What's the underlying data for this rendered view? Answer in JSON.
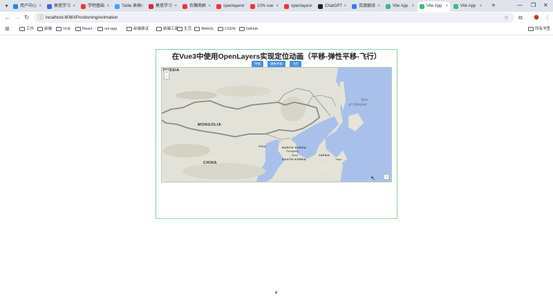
{
  "browser": {
    "tabs": [
      {
        "label": "用户中心",
        "color": "#1e88e5",
        "active": false
      },
      {
        "label": "莫塔学习",
        "color": "#3b6bd6",
        "active": false
      },
      {
        "label": "学吧基础",
        "color": "#e53935",
        "active": false
      },
      {
        "label": "Table 表格",
        "color": "#409eff",
        "active": false
      },
      {
        "label": "莫塔学习",
        "color": "#d32f2f",
        "active": false
      },
      {
        "label": "衣懒蔺群",
        "color": "#e53935",
        "active": false
      },
      {
        "label": "openlayers",
        "color": "#e53935",
        "active": false
      },
      {
        "label": "10% vue",
        "color": "#e53935",
        "active": false
      },
      {
        "label": "openlayers",
        "color": "#e53935",
        "active": false
      },
      {
        "label": "ChatGPT",
        "color": "#222222",
        "active": false
      },
      {
        "label": "百度翻译",
        "color": "#3d7de0",
        "active": false
      },
      {
        "label": "Vite App",
        "color": "#41b883",
        "active": false
      },
      {
        "label": "Vite App",
        "color": "#41b883",
        "active": true
      },
      {
        "label": "Vite App",
        "color": "#41b883",
        "active": false
      }
    ],
    "new_tab": "+",
    "url": "localhost:8080/PositioningAnimation",
    "bookmarks": [
      "工作",
      "前端",
      "VUE",
      "React",
      "uni-app",
      "前端面试",
      "前端工具",
      "生活",
      "WebGL",
      "CSDN",
      "GitHub"
    ],
    "all_bookmarks": "所有书签"
  },
  "page": {
    "title": "在Vue3中使用OpenLayers实现定位动画（平移-弹性平移-飞行）",
    "buttons": [
      "平移",
      "弹性平移",
      "飞行"
    ]
  },
  "map": {
    "zoom_in": "+",
    "zoom_out": "−",
    "attribution": "i",
    "labels": {
      "russia": "RUSSIA",
      "sea": "Sea",
      "sea2": "of Okhotsk",
      "mongolia": "MONGOLIA",
      "china": "CHINA",
      "north_korea": "NORTH KOREA",
      "pyongyang": "Pyongyang",
      "seoul": "Seoul",
      "south_korea": "SOUTH KOREA",
      "japan": "JAPAN",
      "tokyo": "Tokyo",
      "beijing": "Beijing"
    },
    "colors": {
      "water": "#a9c1ea",
      "land": "#e3e2d8",
      "border": "#8a8a8a"
    }
  }
}
